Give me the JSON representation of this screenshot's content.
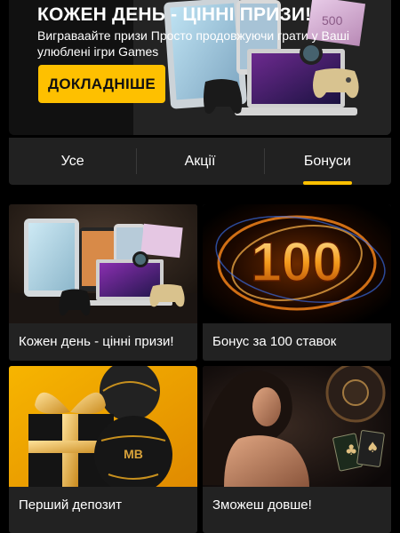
{
  "hero": {
    "title": "КОЖЕН ДЕНЬ - ЦІННІ ПРИЗИ!",
    "subtitle": "Виграваайте призи Просто продовжуючи грати у Ваші улюблені ігри Games",
    "button_label": "ДОКЛАДНІШЕ"
  },
  "tabs": [
    {
      "label": "Усе",
      "active": false
    },
    {
      "label": "Акції",
      "active": false
    },
    {
      "label": "Бонуси",
      "active": true
    }
  ],
  "cards": [
    {
      "label": "Кожен день - цінні призи!",
      "image": "gadgets-prize-image"
    },
    {
      "label": "Бонус за 100 ставок",
      "image": "fiery-100-image",
      "image_text": "100"
    },
    {
      "label": "Перший депозит",
      "image": "gift-box-ball-image"
    },
    {
      "label": "Зможеш довше!",
      "image": "woman-casino-image"
    }
  ],
  "colors": {
    "accent": "#fec000",
    "background": "#000000",
    "panel": "#212121",
    "card": "#222222"
  }
}
